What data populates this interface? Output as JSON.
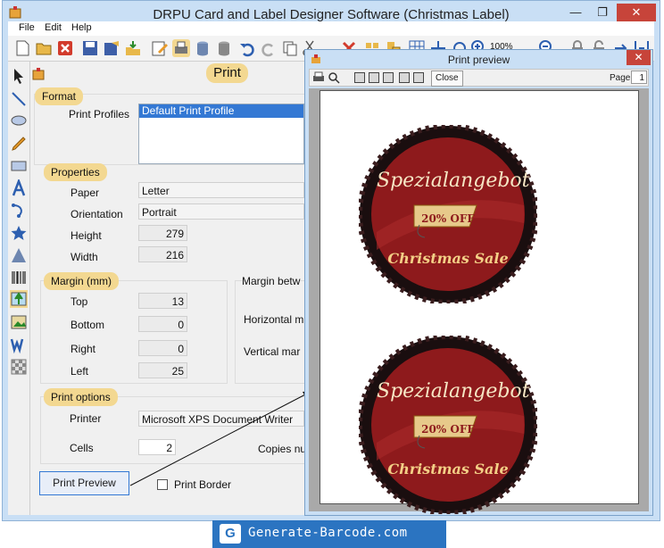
{
  "window": {
    "title": "DRPU Card and Label Designer Software  (Christmas Label)",
    "min_glyph": "—",
    "max_glyph": "❐",
    "close_glyph": "✕"
  },
  "menu": {
    "items": [
      "File",
      "Edit",
      "Help"
    ]
  },
  "toolbar": {
    "zoom": "100%"
  },
  "panel": {
    "title": "Print",
    "format": {
      "section": "Format",
      "profiles_label": "Print Profiles",
      "profiles": [
        "Default Print Profile"
      ]
    },
    "properties": {
      "section": "Properties",
      "paper_label": "Paper",
      "paper": "Letter",
      "orientation_label": "Orientation",
      "orientation": "Portrait",
      "height_label": "Height",
      "height": "279",
      "width_label": "Width",
      "width": "216"
    },
    "margin": {
      "section": "Margin (mm)",
      "top_label": "Top",
      "top": "13",
      "bottom_label": "Bottom",
      "bottom": "0",
      "right_label": "Right",
      "right": "0",
      "left_label": "Left",
      "left": "25",
      "between_label": "Margin betw",
      "horizontal_label": "Horizontal m",
      "vertical_label": "Vertical mar"
    },
    "print_options": {
      "section": "Print options",
      "printer_label": "Printer",
      "printer": "Microsoft XPS Document Writer",
      "cells_label": "Cells",
      "cells": "2",
      "copies_label": "Copies nu"
    },
    "print_preview_button": "Print Preview",
    "print_border_label": "Print Border",
    "print_border_checked": false
  },
  "preview": {
    "title": "Print preview",
    "close_label": "Close",
    "page_label": "Page",
    "page_value": "1",
    "close_glyph": "✕",
    "labels": [
      {
        "headline": "Spezialangebot",
        "tag": "20% OFF",
        "footer": "Christmas Sale"
      },
      {
        "headline": "Spezialangebot",
        "tag": "20% OFF",
        "footer": "Christmas Sale"
      }
    ]
  },
  "brand": {
    "text": "Generate-Barcode.com",
    "logo_letter": "G"
  },
  "colors": {
    "accent": "#f3d891",
    "window": "#c9dff5",
    "label_red": "#8e1a1c",
    "brand_blue": "#2b74c1"
  }
}
